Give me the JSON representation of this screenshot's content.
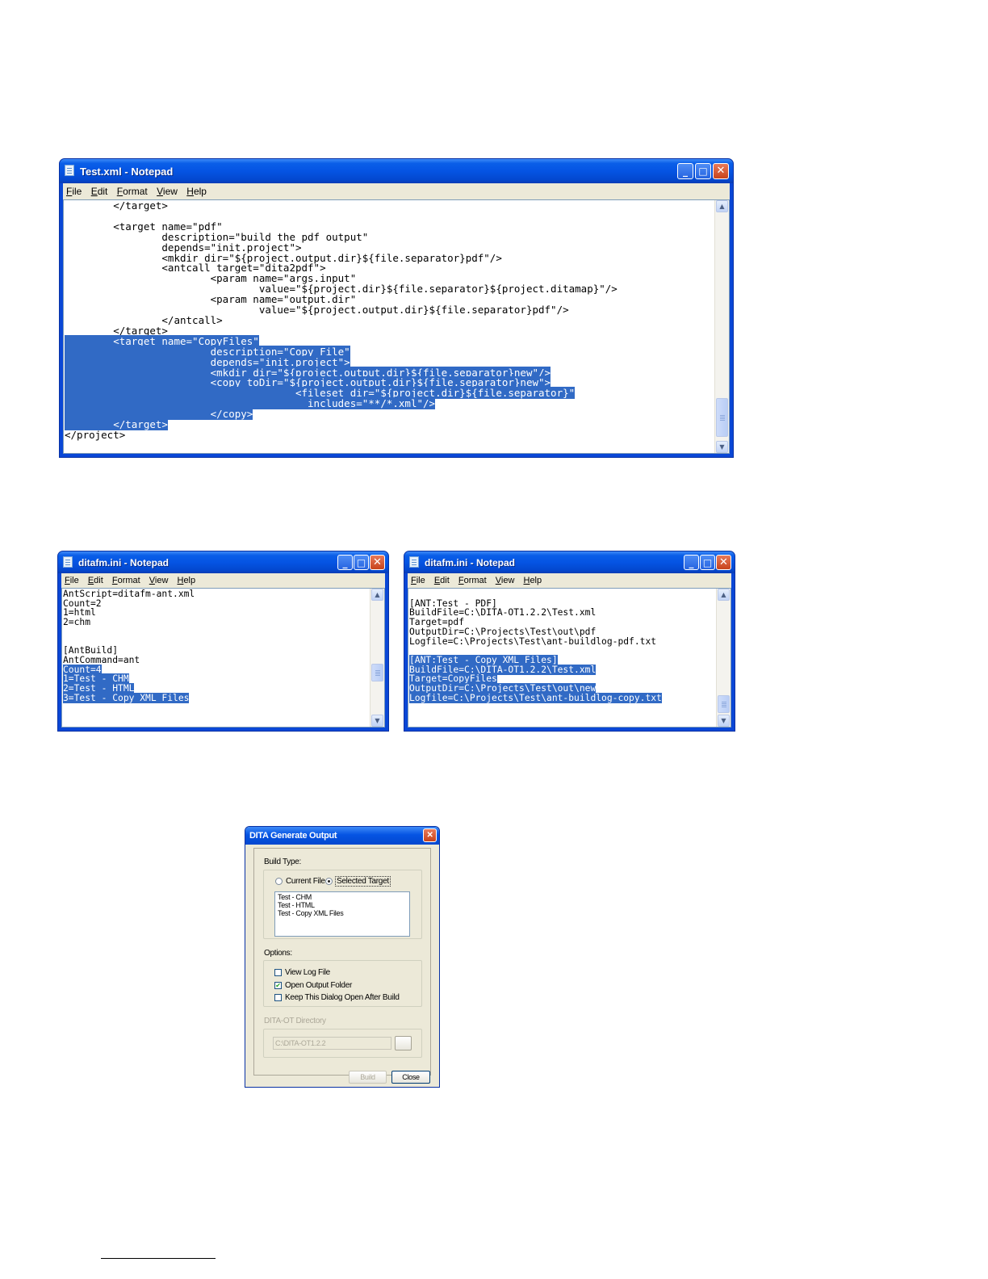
{
  "colors": {
    "selection": "#316ac5",
    "titlebar": "#0554e3",
    "dialog_face": "#ece9d8"
  },
  "window_main": {
    "title": "Test.xml - Notepad",
    "menu": [
      "File",
      "Edit",
      "Format",
      "View",
      "Help"
    ],
    "lines": [
      {
        "text": "        </target>",
        "sel": ""
      },
      {
        "text": "",
        "sel": ""
      },
      {
        "text": "        <target name=\"pdf\"",
        "sel": ""
      },
      {
        "text": "                description=\"build the pdf output\"",
        "sel": ""
      },
      {
        "text": "                depends=\"init.project\">",
        "sel": ""
      },
      {
        "text": "                <mkdir dir=\"${project.output.dir}${file.separator}pdf\"/>",
        "sel": ""
      },
      {
        "text": "                <antcall target=\"dita2pdf\">",
        "sel": ""
      },
      {
        "text": "                        <param name=\"args.input\"",
        "sel": ""
      },
      {
        "text": "                                value=\"${project.dir}${file.separator}${project.ditamap}\"/>",
        "sel": ""
      },
      {
        "text": "                        <param name=\"output.dir\"",
        "sel": ""
      },
      {
        "text": "                                value=\"${project.output.dir}${file.separator}pdf\"/>",
        "sel": ""
      },
      {
        "text": "                </antcall>",
        "sel": ""
      },
      {
        "text": "        </target>",
        "sel": ""
      },
      {
        "text": "",
        "sel": "        <target name=\"CopyFiles\""
      },
      {
        "text": "",
        "sel": "                        description=\"Copy File\""
      },
      {
        "text": "",
        "sel": "                        depends=\"init.project\">"
      },
      {
        "text": "",
        "sel": "                        <mkdir dir=\"${project.output.dir}${file.separator}new\"/>"
      },
      {
        "text": "",
        "sel": "                        <copy toDir=\"${project.output.dir}${file.separator}new\">"
      },
      {
        "text": "",
        "sel": "                                      <fileset dir=\"${project.dir}${file.separator}\""
      },
      {
        "text": "",
        "sel": "                                        includes=\"**/*.xml\"/>"
      },
      {
        "text": "",
        "sel": "                        </copy>"
      },
      {
        "text": "",
        "sel": "        </target>"
      },
      {
        "text": "</project>",
        "sel": ""
      }
    ]
  },
  "window_left": {
    "title": "ditafm.ini - Notepad",
    "menu": [
      "File",
      "Edit",
      "Format",
      "View",
      "Help"
    ],
    "lines": [
      {
        "text": "AntScript=ditafm-ant.xml",
        "sel": ""
      },
      {
        "text": "Count=2",
        "sel": ""
      },
      {
        "text": "1=html",
        "sel": ""
      },
      {
        "text": "2=chm",
        "sel": ""
      },
      {
        "text": "",
        "sel": ""
      },
      {
        "text": "",
        "sel": ""
      },
      {
        "text": "[AntBuild]",
        "sel": ""
      },
      {
        "text": "AntCommand=ant",
        "sel": ""
      },
      {
        "text": "",
        "sel": "Count=4"
      },
      {
        "text": "",
        "sel": "1=Test - CHM"
      },
      {
        "text": "",
        "sel": "2=Test - HTML"
      },
      {
        "text": "",
        "sel": "3=Test - Copy XML Files"
      }
    ]
  },
  "window_right": {
    "title": "ditafm.ini - Notepad",
    "menu": [
      "File",
      "Edit",
      "Format",
      "View",
      "Help"
    ],
    "lines": [
      {
        "text": "",
        "sel": ""
      },
      {
        "text": "[ANT:Test - PDF]",
        "sel": ""
      },
      {
        "text": "BuildFile=C:\\DITA-OT1.2.2\\Test.xml",
        "sel": ""
      },
      {
        "text": "Target=pdf",
        "sel": ""
      },
      {
        "text": "OutputDir=C:\\Projects\\Test\\out\\pdf",
        "sel": ""
      },
      {
        "text": "Logfile=C:\\Projects\\Test\\ant-buildlog-pdf.txt",
        "sel": ""
      },
      {
        "text": "",
        "sel": ""
      },
      {
        "text": "",
        "sel": "[ANT:Test - Copy XML Files]"
      },
      {
        "text": "",
        "sel": "BuildFile=C:\\DITA-OT1.2.2\\Test.xml"
      },
      {
        "text": "",
        "sel": "Target=CopyFiles"
      },
      {
        "text": "",
        "sel": "OutputDir=C:\\Projects\\Test\\out\\new"
      },
      {
        "text": "",
        "sel": "Logfile=C:\\Projects\\Test\\ant-buildlog-copy.txt"
      }
    ]
  },
  "dialog": {
    "title": "DITA Generate Output",
    "build_type_label": "Build Type:",
    "radio_current": "Current File",
    "radio_selected": "Selected Target",
    "targets": [
      "Test - CHM",
      "Test - HTML",
      "Test - Copy XML Files"
    ],
    "options_label": "Options:",
    "opt_view_log": "View Log File",
    "opt_open_output": "Open Output Folder",
    "opt_keep_open": "Keep This Dialog Open After Build",
    "dita_ot_label": "DITA-OT Directory",
    "dita_ot_value": "C:\\DITA-OT1.2.2",
    "build_button": "Build",
    "close_button": "Close"
  }
}
